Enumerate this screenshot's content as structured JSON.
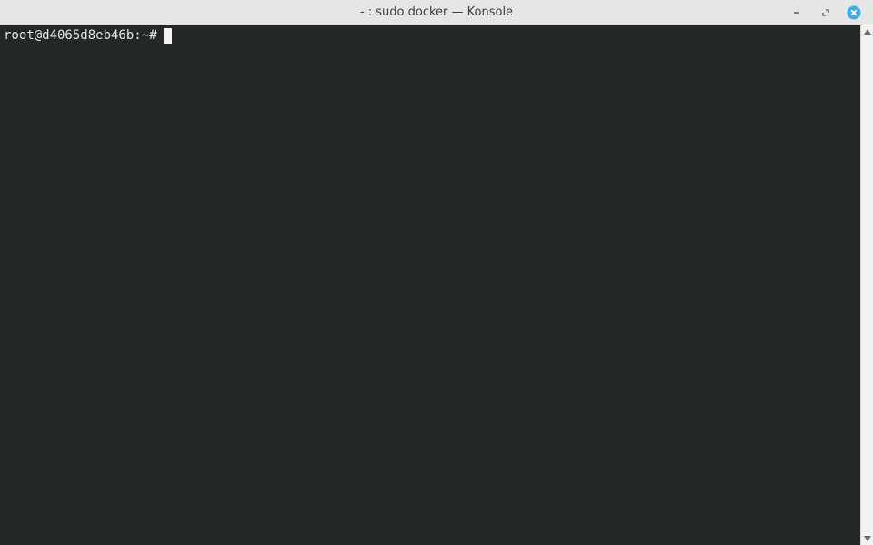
{
  "window": {
    "title": "- : sudo docker — Konsole"
  },
  "terminal": {
    "prompt": "root@d4065d8eb46b:~#"
  },
  "icons": {
    "minimize": "minimize-icon",
    "maximize": "restore-icon",
    "close": "close-icon",
    "scroll_up": "arrow-up-icon",
    "scroll_down": "arrow-down-icon"
  },
  "colors": {
    "terminal_bg": "#232728",
    "terminal_fg": "#e6e6e6",
    "titlebar_bg": "#e6e6e6",
    "close_accent": "#3daee9"
  }
}
